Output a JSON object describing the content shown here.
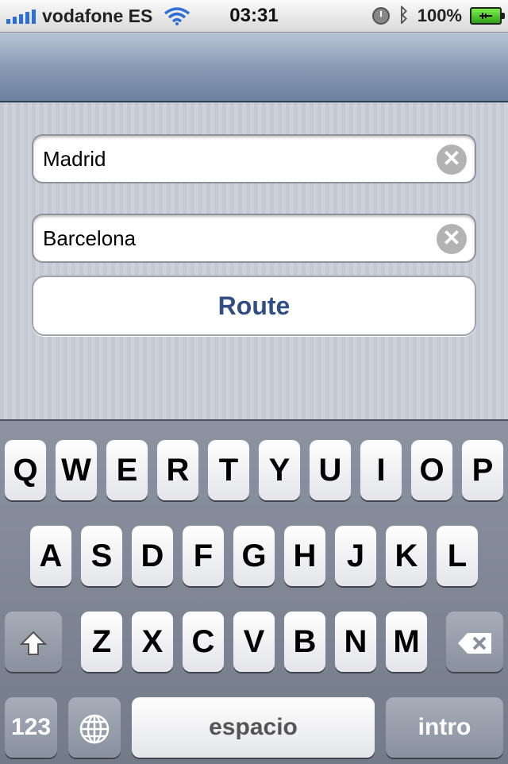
{
  "status_bar": {
    "carrier": "vodafone ES",
    "time": "03:31",
    "battery": "100%"
  },
  "form": {
    "origin": {
      "value": "Madrid"
    },
    "destination": {
      "value": "Barcelona"
    },
    "route_label": "Route"
  },
  "keyboard": {
    "row1": [
      "Q",
      "W",
      "E",
      "R",
      "T",
      "Y",
      "U",
      "I",
      "O",
      "P"
    ],
    "row2": [
      "A",
      "S",
      "D",
      "F",
      "G",
      "H",
      "J",
      "K",
      "L"
    ],
    "row3": [
      "Z",
      "X",
      "C",
      "V",
      "B",
      "N",
      "M"
    ],
    "numbers_label": "123",
    "space_label": "espacio",
    "return_label": "intro"
  }
}
